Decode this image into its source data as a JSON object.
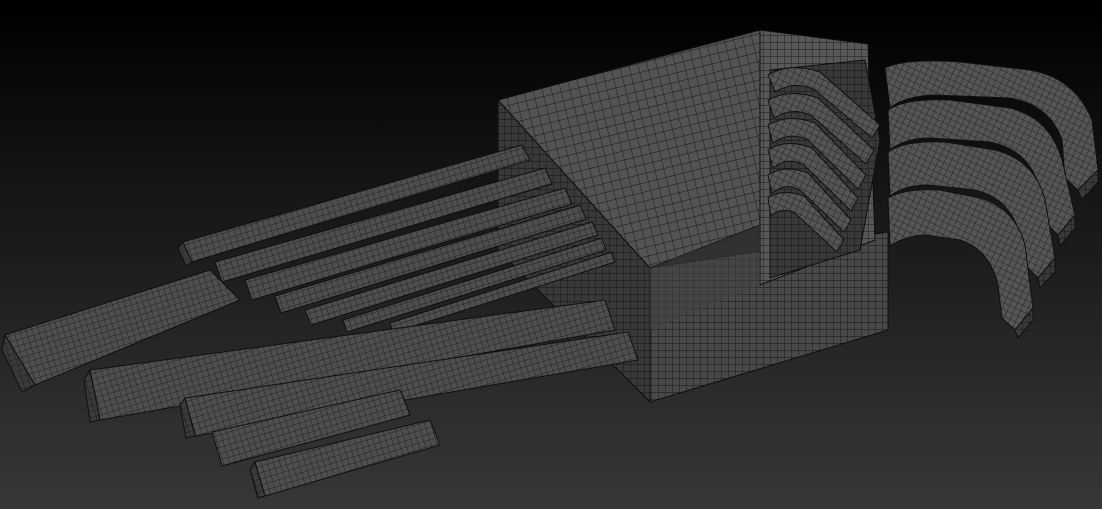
{
  "viewport": {
    "subject": "hex-key-set-wireframe-mesh",
    "render_style": "polygon-wireframe",
    "background_colors": [
      "#000000",
      "#262626",
      "#3a3a3a"
    ],
    "mesh_base_color": "#4d4d4d",
    "mesh_line_color": "#161616",
    "mesh_highlight_color": "#6a6a6a",
    "mesh_shadow_color": "#2e2e2e"
  },
  "scene": {
    "holder": {
      "visible": true
    },
    "straight_key_ends": {
      "count": 10
    },
    "bent_key_ends_large": {
      "count": 4
    },
    "bent_key_ends_small": {
      "count": 6
    }
  }
}
